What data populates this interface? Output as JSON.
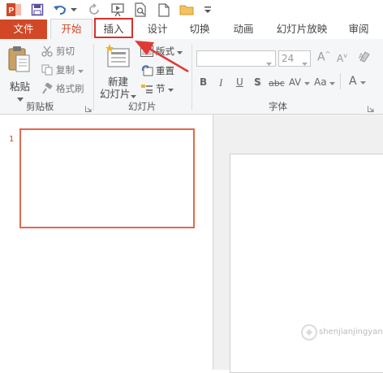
{
  "qat": {
    "app_icon": "powerpoint-icon",
    "icons": [
      "save-icon",
      "undo-icon",
      "dropdown-arrow-icon",
      "redo-icon",
      "from-beginning-icon",
      "print-preview-icon",
      "new-icon",
      "open-icon",
      "customize-icon"
    ]
  },
  "tabs": {
    "file": "文件",
    "home": "开始",
    "insert": "插入",
    "design": "设计",
    "transitions": "切换",
    "animations": "动画",
    "slideshow": "幻灯片放映",
    "review": "审阅"
  },
  "ribbon": {
    "clipboard": {
      "paste": "粘贴",
      "cut": "剪切",
      "copy": "复制",
      "format_painter": "格式刷",
      "label": "剪贴板"
    },
    "slides": {
      "new_slide_line1": "新建",
      "new_slide_line2": "幻灯片",
      "layout": "版式",
      "reset": "重置",
      "section": "节",
      "label": "幻灯片"
    },
    "font": {
      "font_name": "",
      "font_size": "24",
      "bold": "B",
      "italic": "I",
      "underline": "U",
      "shadow": "S",
      "strikethrough": "abc",
      "spacing": "AV",
      "change_case": "Aa",
      "font_color": "A",
      "grow": "A",
      "shrink": "A",
      "label": "字体"
    }
  },
  "slides_panel": {
    "slide_number": "1"
  },
  "colors": {
    "accent": "#d24726",
    "highlight_box": "#d9302c",
    "arrow": "#e03a36"
  },
  "watermark": "shenjianjingyan"
}
